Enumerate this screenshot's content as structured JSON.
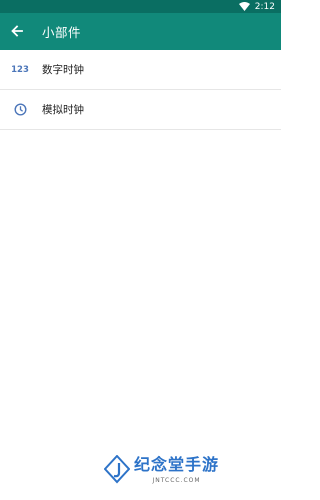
{
  "status_bar": {
    "time": "2:12"
  },
  "app_bar": {
    "title": "小部件"
  },
  "list": {
    "items": [
      {
        "label": "数字时钟",
        "icon": "digits-123-icon",
        "icon_text": "123"
      },
      {
        "label": "模拟时钟",
        "icon": "clock-icon"
      }
    ]
  },
  "watermark": {
    "brand": "纪念堂手游",
    "url": "JNTCCC.COM"
  },
  "colors": {
    "status_bar": "#0a6e62",
    "app_bar": "#11897a",
    "icon_blue": "#4c76b9",
    "brand_blue": "#2d73c8"
  }
}
